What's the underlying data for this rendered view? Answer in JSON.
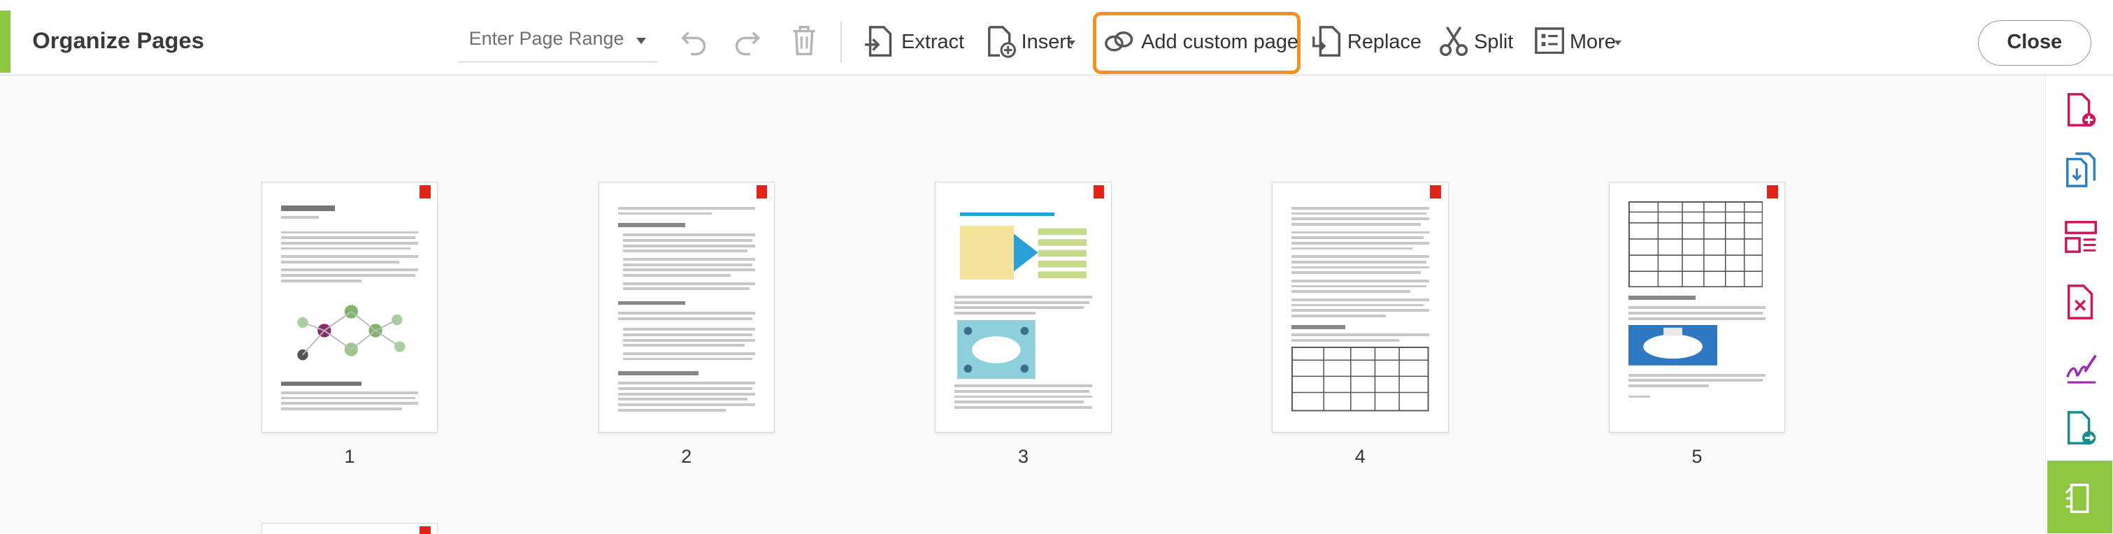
{
  "header": {
    "title": "Organize Pages"
  },
  "page_range": {
    "placeholder": "Enter Page Range",
    "value": ""
  },
  "toolbar": {
    "extract": "Extract",
    "insert": "Insert",
    "add_custom_page": "Add custom page",
    "replace": "Replace",
    "split": "Split",
    "more": "More",
    "close": "Close"
  },
  "pages": [
    {
      "number": "1"
    },
    {
      "number": "2"
    },
    {
      "number": "3"
    },
    {
      "number": "4"
    },
    {
      "number": "5"
    }
  ],
  "colors": {
    "accent_green": "#8dc63f",
    "highlight_orange": "#f39220",
    "adobe_red": "#e2231a",
    "rail_icon_pink": "#d4145a",
    "rail_icon_blue": "#2d7fc1",
    "rail_icon_purple": "#9b2fae",
    "rail_icon_teal": "#1a8c8c"
  }
}
